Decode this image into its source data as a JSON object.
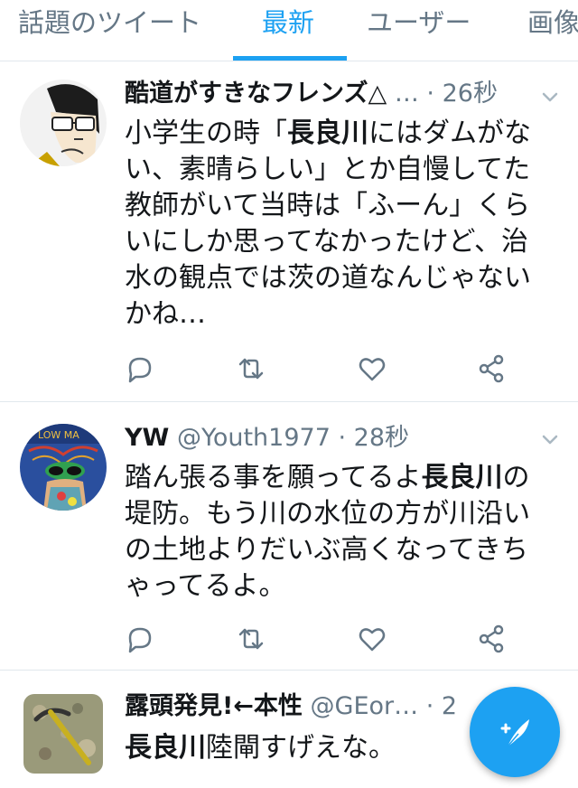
{
  "tabs": [
    {
      "label": "話題のツイート"
    },
    {
      "label": "最新"
    },
    {
      "label": "ユーザー"
    },
    {
      "label": "画像"
    }
  ],
  "tweets": [
    {
      "name": "酷道がすきなフレンズ△",
      "handle": "…",
      "time": "· 26秒",
      "text_parts": [
        "小学生の時「",
        "長良川",
        "にはダムがない、素晴らしい」とか自慢してた教師がいて当時は「ふーん」くらいにしか思ってなかったけど、治水の観点では茨の道なんじゃないかね…"
      ]
    },
    {
      "name": "YW",
      "handle": "@Youth1977",
      "time": "· 28秒",
      "text_parts": [
        "踏ん張る事を願ってるよ",
        "長良川",
        "の堤防。もう川の水位の方が川沿いの土地よりだいぶ高くなってきちゃってるよ。"
      ]
    },
    {
      "name": "露頭発見!←本性",
      "handle": "@GEor…",
      "time": "· 2",
      "text_parts": [
        "長良川",
        "陸閘すげえな。"
      ]
    }
  ],
  "colors": {
    "accent": "#1da1f2",
    "text": "#14171a",
    "secondary": "#657786",
    "divider": "#e1e8ed"
  },
  "icons": {
    "reply": "reply-icon",
    "retweet": "retweet-icon",
    "like": "like-icon",
    "share": "share-icon",
    "compose": "compose-icon",
    "chevron": "chevron-down-icon"
  }
}
